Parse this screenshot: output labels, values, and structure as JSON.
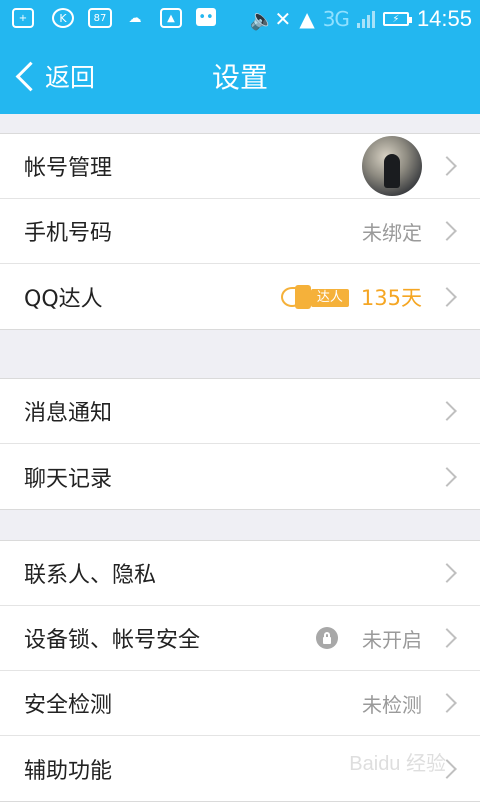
{
  "status_bar": {
    "network": "3G",
    "time": "14:55",
    "notif_k": "K",
    "notif_87": "87"
  },
  "header": {
    "back_label": "返回",
    "title": "设置"
  },
  "groups": [
    {
      "rows": [
        {
          "label": "帐号管理"
        },
        {
          "label": "手机号码",
          "value": "未绑定"
        },
        {
          "label": "QQ达人",
          "badge": "达人",
          "value": "135天"
        }
      ]
    },
    {
      "rows": [
        {
          "label": "消息通知"
        },
        {
          "label": "聊天记录"
        }
      ]
    },
    {
      "rows": [
        {
          "label": "联系人、隐私"
        },
        {
          "label": "设备锁、帐号安全",
          "value": "未开启"
        },
        {
          "label": "安全检测",
          "value": "未检测"
        },
        {
          "label": "辅助功能"
        }
      ]
    }
  ],
  "colors": {
    "accent": "#23b7f0",
    "daren": "#f5a623"
  },
  "watermark": "Baidu 经验"
}
